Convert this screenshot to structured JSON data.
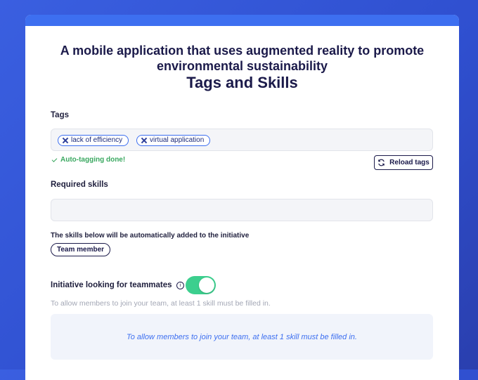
{
  "header": {
    "initiative_title": "A mobile application that uses augmented reality to promote environmental sustainability",
    "section_title": "Tags and Skills"
  },
  "tags": {
    "label": "Tags",
    "items": [
      {
        "label": "lack of efficiency",
        "remove_icon": "close-icon"
      },
      {
        "label": "virtual application",
        "remove_icon": "close-icon"
      }
    ],
    "status": "Auto-tagging done!",
    "reload_label": "Reload tags"
  },
  "skills": {
    "label": "Required skills",
    "value": "",
    "auto_note": "The skills below will be automatically added to the initiative",
    "auto_items": [
      "Team member"
    ]
  },
  "teammates": {
    "label": "Initiative looking for teammates",
    "info_icon": "i",
    "toggle_on": true,
    "hint": "To allow members to join your team, at least 1 skill must be filled in.",
    "notice": "To allow members to join your team, at least 1 skill must be filled in."
  },
  "colors": {
    "accent": "#3d6ff0",
    "toggle_on": "#3ccf8e",
    "success": "#3aa860",
    "title": "#1b1a4a"
  }
}
